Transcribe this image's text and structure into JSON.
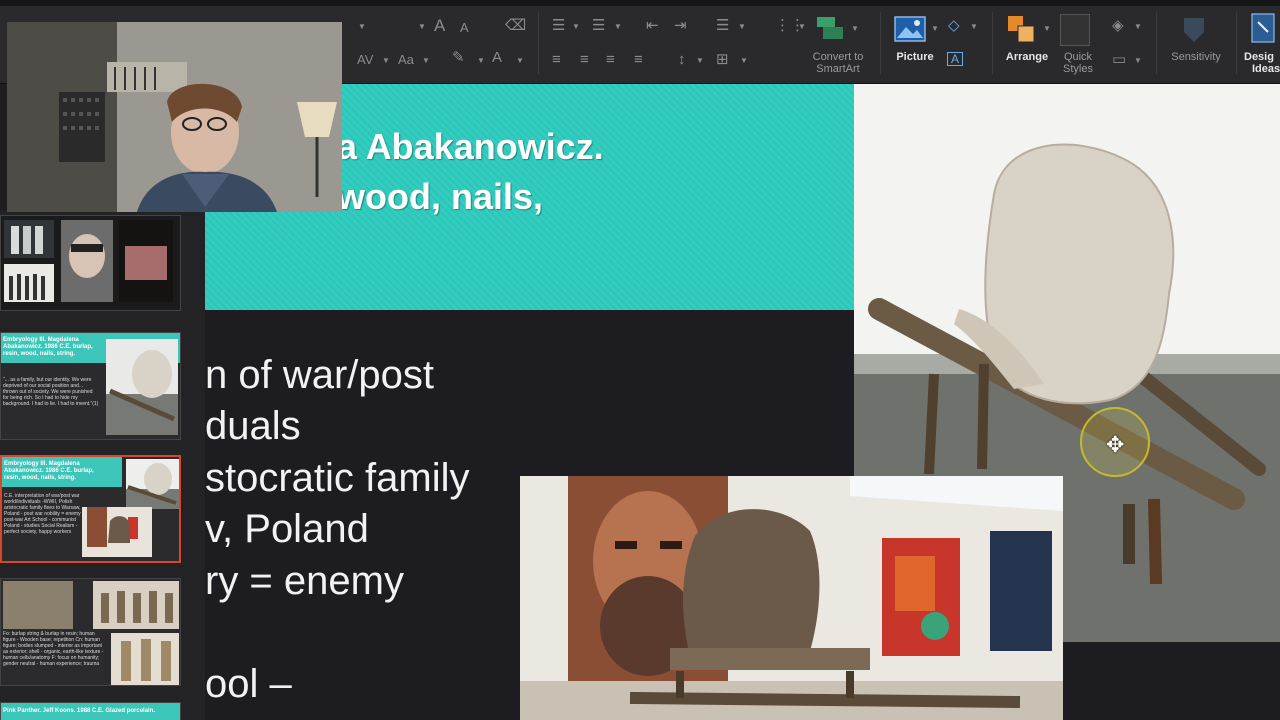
{
  "ribbon": {
    "smartart_label_1": "Convert to",
    "smartart_label_2": "SmartArt",
    "picture_label": "Picture",
    "arrange_label": "Arrange",
    "quick_styles_label_1": "Quick",
    "quick_styles_label_2": "Styles",
    "sensitivity_label": "Sensitivity",
    "design_ideas_label_1": "Desig",
    "design_ideas_label_2": "Ideas",
    "font_size_label": "A",
    "font_size_small_label": "A",
    "char_spacing_label": "AV",
    "change_case_label": "Aa",
    "font_color_label": "A"
  },
  "slide": {
    "title_line1": "a Abakanowicz.",
    "title_line2": "wood, nails,",
    "body_lines": [
      "n of war/post",
      "duals",
      "stocratic family",
      "v, Poland",
      "ry = enemy",
      "ool –"
    ]
  },
  "thumbnails": [
    {
      "title": ""
    },
    {
      "title": "Embryology III. Magdalena Abakanowicz. 1986 C.E. burlap, resin, wood, nails, string.",
      "body": "“... as a family, but our identity. We were deprived of our social position and... thrown out of society. We were punished for being rich. So I had to hide my background. I had to lie. I had to invent.”(1)"
    },
    {
      "title": "Embryology III. Magdalena Abakanowicz. 1986 C.E. burlap, resin, wood, nails, string.",
      "body": "C.E. interpretation of war/post war world/individuals -WWII, Polish aristocratic family flees to Warsaw, Poland - post war nobility = enemy - post-war Art School - communist Poland - studies Social Realism - perfect society, happy workers"
    },
    {
      "title": "",
      "body": "Fo: burlap string & burlap in resin; human figure - Wooden base; repetition Cn: human figure; bodies slumped - interior as important as exterior; shell - organic, earth-like texture - human cells/anatomy F: focus on humanity; gender neutral - human experience; trauma"
    },
    {
      "title": "Pink Panther. Jeff Koons. 1988 C.E. Glazed porcelain."
    }
  ],
  "colors": {
    "accent_teal": "#33ccbf",
    "slide_dark": "#1d1d21",
    "selection_orange": "#d8462b"
  }
}
